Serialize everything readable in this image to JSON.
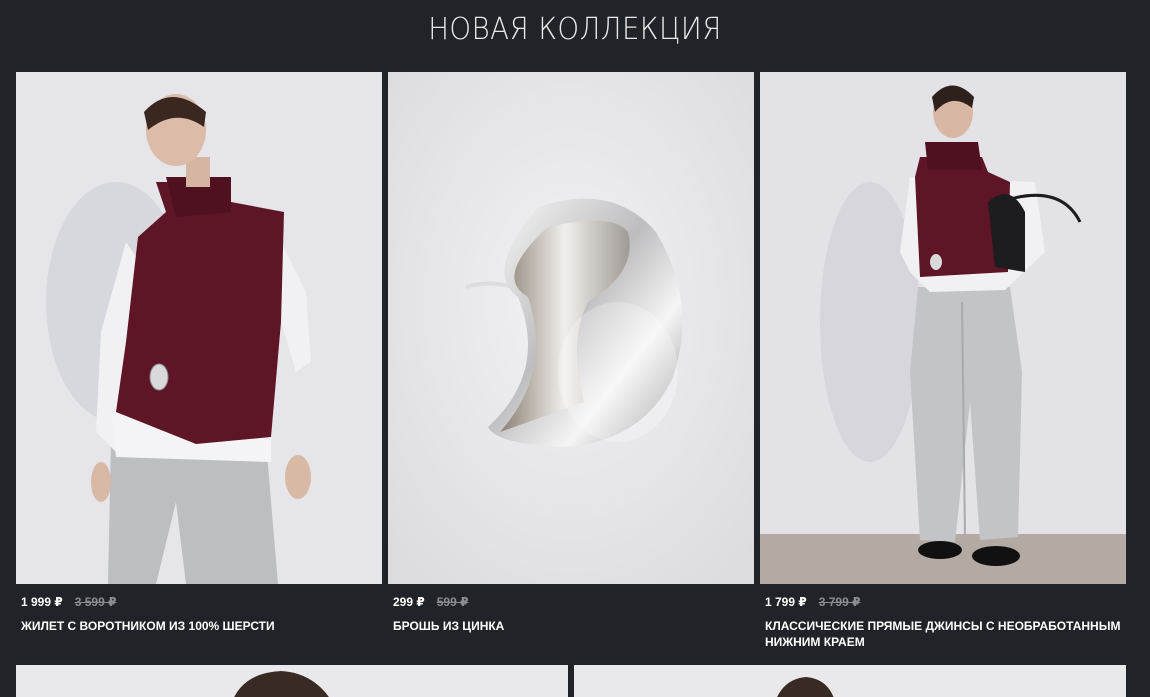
{
  "section": {
    "title": "НОВАЯ КОЛЛЕКЦИЯ"
  },
  "products": [
    {
      "price": "1 999 ₽",
      "old_price": "3 599 ₽",
      "name": "ЖИЛЕТ С ВОРОТНИКОМ ИЗ 100% ШЕРСТИ"
    },
    {
      "price": "299 ₽",
      "old_price": "599 ₽",
      "name": "БРОШЬ ИЗ ЦИНКА"
    },
    {
      "price": "1 799 ₽",
      "old_price": "3 799 ₽",
      "name": "КЛАССИЧЕСКИЕ ПРЯМЫЕ ДЖИНСЫ С НЕОБРАБОТАННЫМ НИЖНИМ КРАЕМ"
    }
  ],
  "colors": {
    "background": "#202327",
    "knit_burgundy": "#5e1526",
    "denim_grey": "#b9babd",
    "studio_wall": "#e6e6ea",
    "price_old": "#8a8d92"
  }
}
